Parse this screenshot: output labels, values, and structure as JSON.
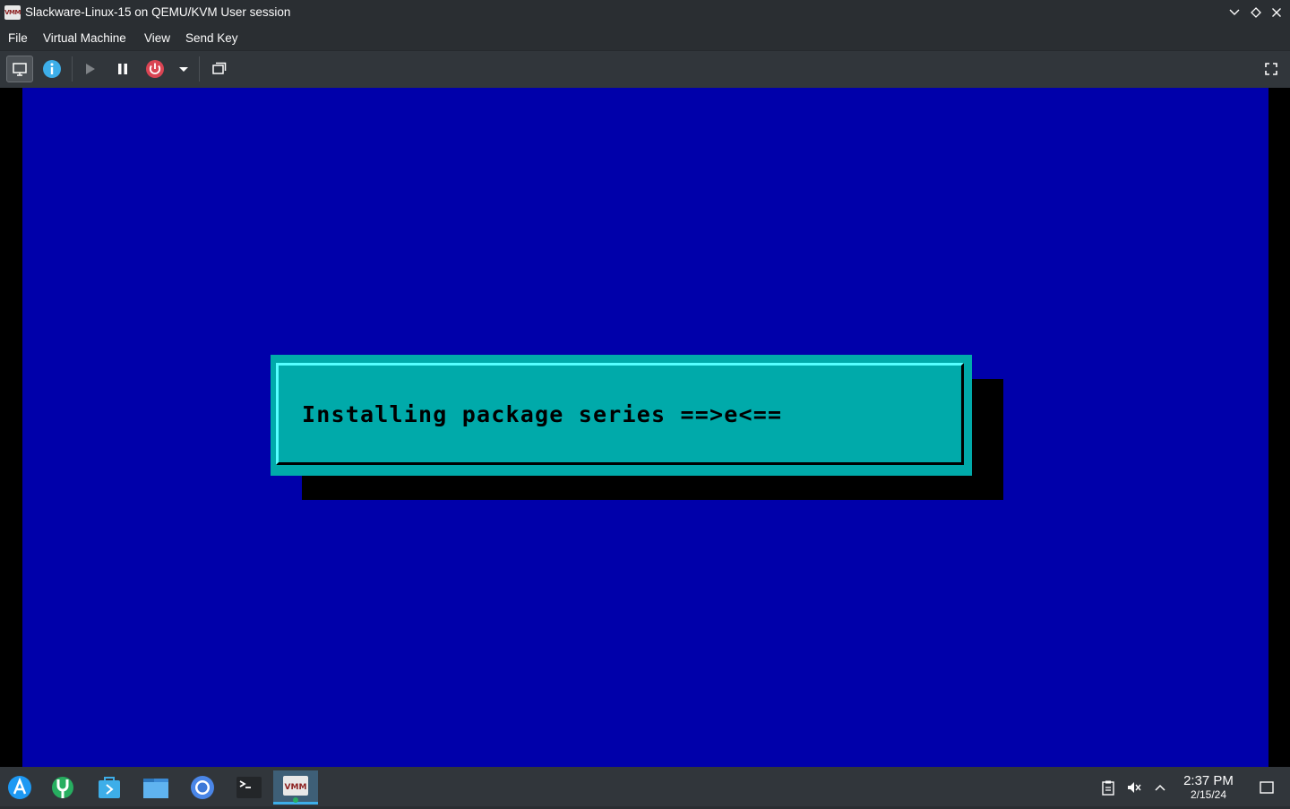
{
  "window": {
    "title": "Slackware-Linux-15 on QEMU/KVM User session",
    "app_icon_text": "VMM"
  },
  "menu": {
    "items": [
      "File",
      "Virtual Machine",
      "View",
      "Send Key"
    ]
  },
  "toolbar": {
    "buttons": [
      "console-icon",
      "info-icon",
      "run-icon",
      "pause-icon",
      "power-icon",
      "dropdown-icon",
      "snapshots-icon",
      "fullscreen-icon"
    ]
  },
  "vm_console": {
    "message": "Installing package series ==>e<==",
    "colors": {
      "background": "#0000aa",
      "dialog": "#00aaaa",
      "highlight": "#55ffff",
      "shadow": "#000000"
    }
  },
  "taskbar": {
    "apps": [
      "launcher-icon",
      "discover-icon",
      "store-icon",
      "files-icon",
      "chromium-icon",
      "terminal-icon",
      "virt-manager-icon"
    ],
    "clock": {
      "time": "2:37 PM",
      "date": "2/15/24"
    }
  }
}
